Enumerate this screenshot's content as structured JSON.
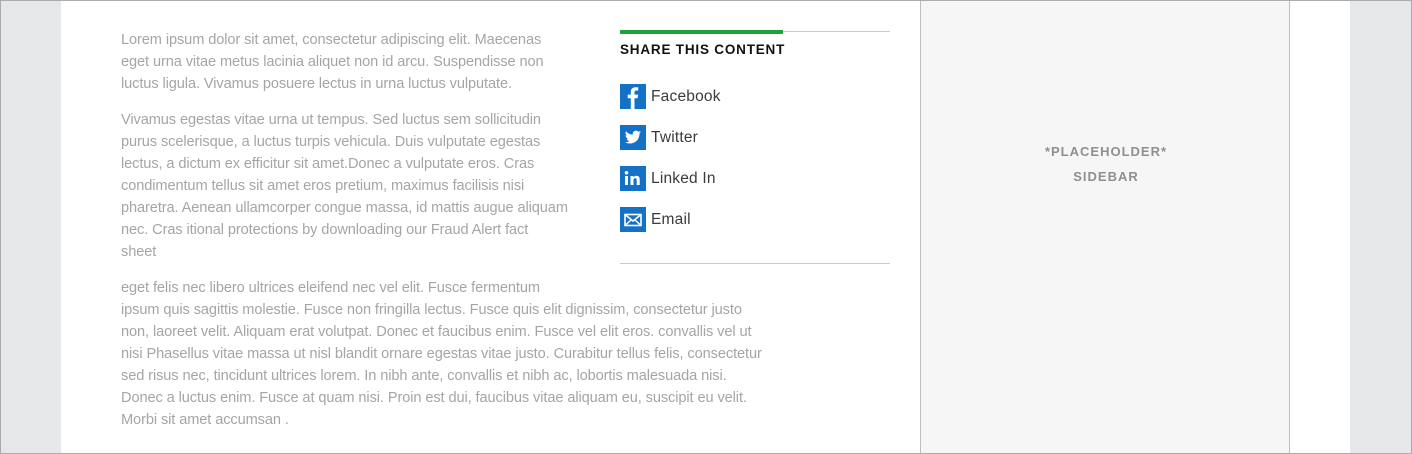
{
  "article": {
    "para1": [
      "Lorem ipsum dolor sit amet, consectetur adipiscing elit. Maecenas",
      "eget urna vitae metus lacinia aliquet non id arcu. Suspendisse non",
      "luctus ligula. Vivamus posuere lectus in urna luctus vulputate."
    ],
    "para2": [
      "Vivamus egestas vitae urna ut tempus. Sed luctus sem sollicitudin",
      "purus scelerisque, a luctus turpis vehicula. Duis vulputate egestas",
      "lectus, a dictum ex efficitur sit amet.Donec a vulputate eros. Cras",
      "condimentum tellus sit amet eros pretium, maximus facilisis nisi",
      "pharetra. Aenean ullamcorper congue massa, id mattis augue aliquam",
      "nec. Cras itional protections by downloading our Fraud Alert fact",
      "sheet"
    ],
    "para3": [
      "eget felis nec libero ultrices eleifend nec vel elit. Fusce fermentum",
      "ipsum quis sagittis molestie. Fusce non fringilla lectus. Fusce quis elit dignissim, consectetur justo",
      "non, laoreet velit. Aliquam erat volutpat. Donec et faucibus enim. Fusce vel elit eros. convallis vel ut",
      "nisi Phasellus vitae massa ut nisl blandit ornare egestas vitae justo. Curabitur tellus felis, consectetur",
      "sed risus nec, tincidunt ultrices lorem. In nibh ante, convallis et nibh ac, lobortis malesuada nisi.",
      "Donec a luctus enim. Fusce at quam nisi. Proin est dui, faucibus vitae aliquam eu, suscipit eu velit.",
      "Morbi sit amet accumsan ."
    ]
  },
  "share": {
    "heading": "SHARE THIS CONTENT",
    "accent_color": "#20a23a",
    "icon_color": "#1371c7",
    "items": [
      {
        "label": "Facebook",
        "icon": "facebook-icon"
      },
      {
        "label": "Twitter",
        "icon": "twitter-icon"
      },
      {
        "label": "Linked In",
        "icon": "linkedin-icon"
      },
      {
        "label": "Email",
        "icon": "email-icon"
      }
    ]
  },
  "sidebar": {
    "line1": "*PLACEHOLDER*",
    "line2": "SIDEBAR"
  }
}
